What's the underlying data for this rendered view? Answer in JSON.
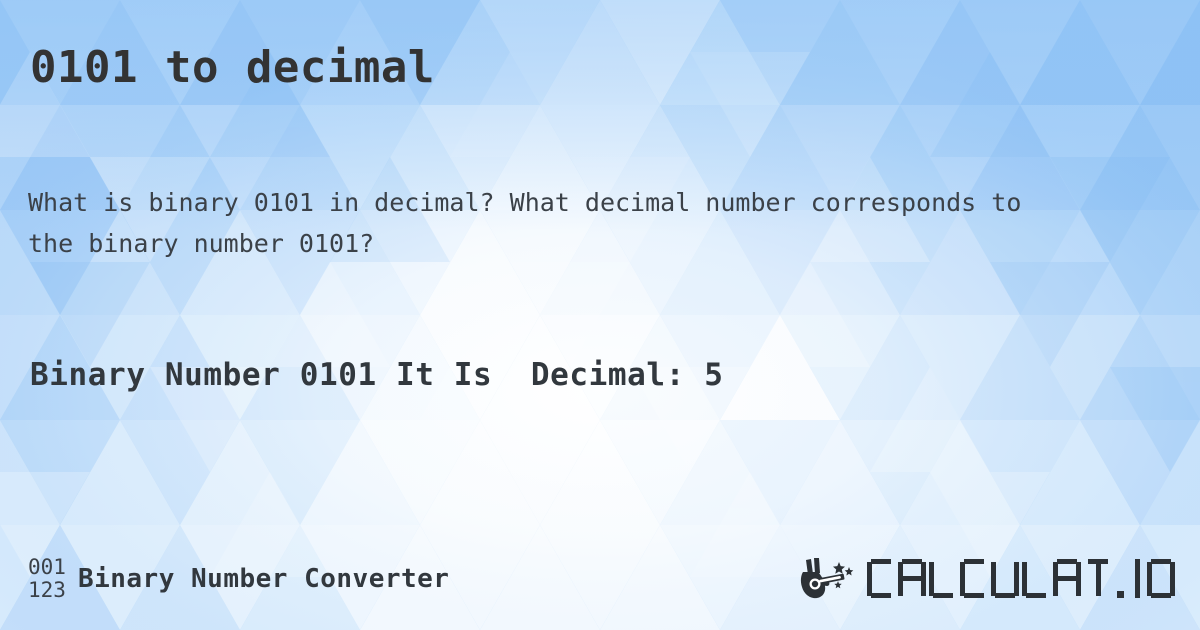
{
  "meta": {
    "card_type": "social-share-card",
    "background_style": "low-poly triangle mosaic",
    "background_colors": {
      "base": "#bfdcfa",
      "deep_blue": "#8cc2f6",
      "mid_blue": "#aed4f8",
      "light_blue": "#d4e8fb",
      "pale": "#e9f3fd",
      "highlight": "#ffffff"
    },
    "text_colors": {
      "title": "#333333",
      "body": "#3b4148",
      "result": "#32383e",
      "logo": "#2c3136"
    }
  },
  "header": {
    "title": "0101 to decimal"
  },
  "main": {
    "question": "What is binary 0101 in decimal? What decimal number corresponds to the binary number 0101?",
    "result_line": "Binary Number 0101 It Is  Decimal: 5",
    "binary_value": "0101",
    "decimal_value": "5"
  },
  "footer": {
    "brand_left": {
      "icon_top": "001",
      "icon_bottom": "123",
      "label": "Binary Number Converter"
    },
    "brand_right": {
      "icon": "magic-wand-hand-icon",
      "wordmark": "CALCULAT.IO",
      "wordmark_letters": [
        "C",
        "A",
        "L",
        "C",
        "U",
        "L",
        "A",
        "T",
        ".",
        "I",
        "O"
      ]
    }
  }
}
